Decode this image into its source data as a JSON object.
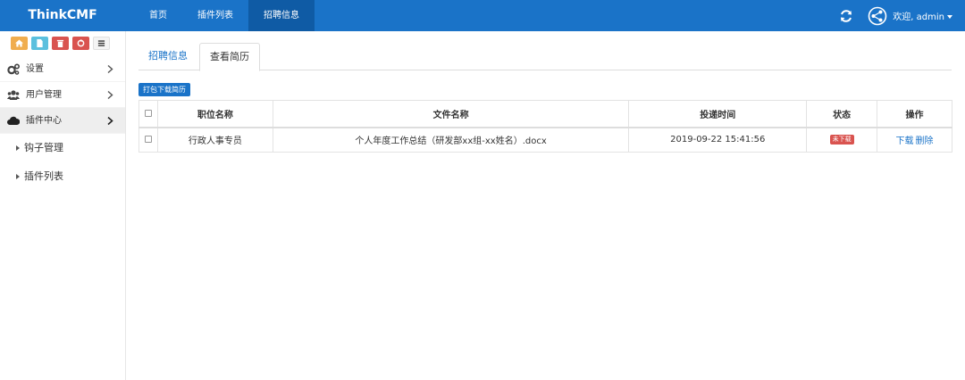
{
  "app": {
    "brand": "ThinkCMF"
  },
  "nav": {
    "items": [
      {
        "label": "首页"
      },
      {
        "label": "插件列表"
      },
      {
        "label": "招聘信息"
      }
    ]
  },
  "header": {
    "user": "欢迎, admin"
  },
  "sidebar": {
    "quick_buttons": [
      {
        "icon": "home-icon",
        "color": "#f0ad4e"
      },
      {
        "icon": "file-icon",
        "color": "#5bc0de"
      },
      {
        "icon": "trash-icon",
        "color": "#d9534f"
      },
      {
        "icon": "recycle-icon",
        "color": "#d9534f"
      },
      {
        "icon": "list-icon",
        "color": "#f4f4f4"
      }
    ],
    "menu": [
      {
        "label": "设置",
        "icon": "gears-icon"
      },
      {
        "label": "用户管理",
        "icon": "users-icon"
      },
      {
        "label": "插件中心",
        "icon": "cloud-icon"
      }
    ],
    "submenu": [
      {
        "label": "钩子管理"
      },
      {
        "label": "插件列表"
      }
    ]
  },
  "tabs": [
    {
      "label": "招聘信息"
    },
    {
      "label": "查看简历"
    }
  ],
  "toolbar": {
    "pack_download": "打包下载简历"
  },
  "table": {
    "headers": [
      "职位名称",
      "文件名称",
      "投递时间",
      "状态",
      "操作"
    ],
    "rows": [
      {
        "position": "行政人事专员",
        "file": "个人年度工作总结（研发部xx组-xx姓名）.docx",
        "time": "2019-09-22 15:41:56",
        "status": "未下载",
        "action_download": "下载",
        "action_delete": "删除"
      }
    ]
  },
  "colors": {
    "primary": "#1a73c8",
    "danger": "#d9534f",
    "warning": "#f0ad4e",
    "info": "#5bc0de"
  }
}
